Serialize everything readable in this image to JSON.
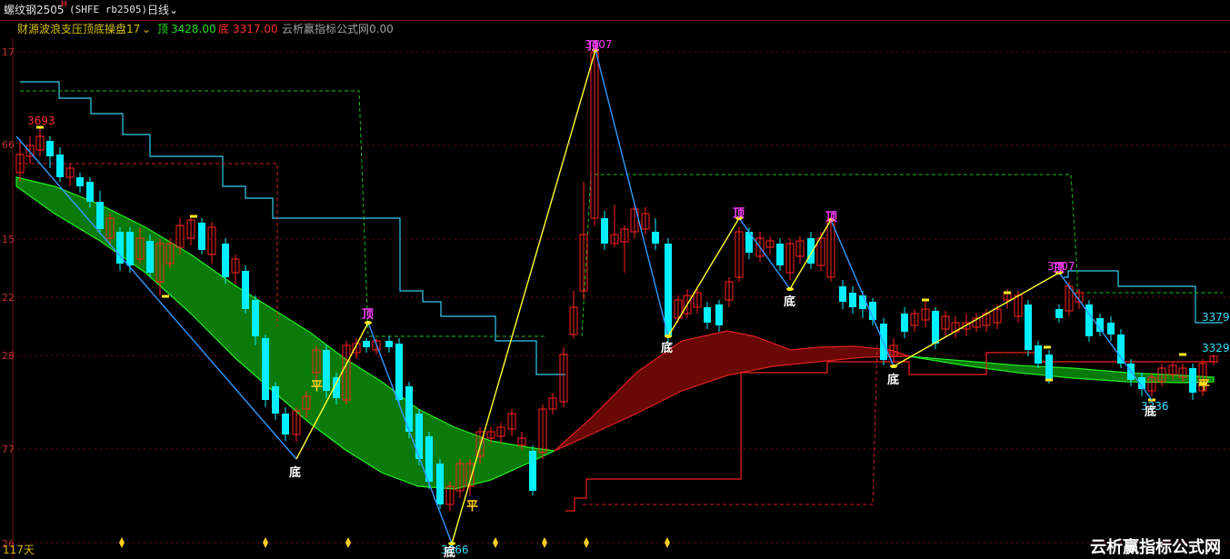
{
  "header": {
    "symbol_label": "螺纹钢2505",
    "symbol_superscript": "M",
    "contract_code": "(SHFE rb2505)",
    "period_label": "日线",
    "period_chevron": "chevron-down-icon"
  },
  "indicator_bar": {
    "name": "财源波浪支压顶底操盘17",
    "top_label": "顶",
    "top_value": "3428.00",
    "bottom_label": "底",
    "bottom_value": "3317.00",
    "source_label": "云析赢指标公式网",
    "source_value": "0.00"
  },
  "y_axis_labels": [
    "17",
    "66",
    "15",
    "22",
    "28",
    "77",
    "26"
  ],
  "annotations": {
    "high_value": "3693",
    "peak_value": "3407",
    "right_upper_value": "3379",
    "right_lower_value": "3329",
    "low_value": "3066",
    "right_low_value": "3236",
    "right_peak_value": "3407",
    "top_text": "顶",
    "bottom_text": "底",
    "flat_text": "平"
  },
  "footer": {
    "days_label": "117天",
    "watermark": "云析赢指标公式网"
  },
  "colors": {
    "up": "#ff2020",
    "down": "#00f0ff",
    "cloud_bull": "#0a7a0a",
    "cloud_bear": "#6a0808",
    "zigzag_up": "#ffff33",
    "zigzag_down": "#3399ff",
    "step_line": "#33ccee",
    "label_top": "#ff40ff",
    "label_bottom": "#ffffff"
  }
}
